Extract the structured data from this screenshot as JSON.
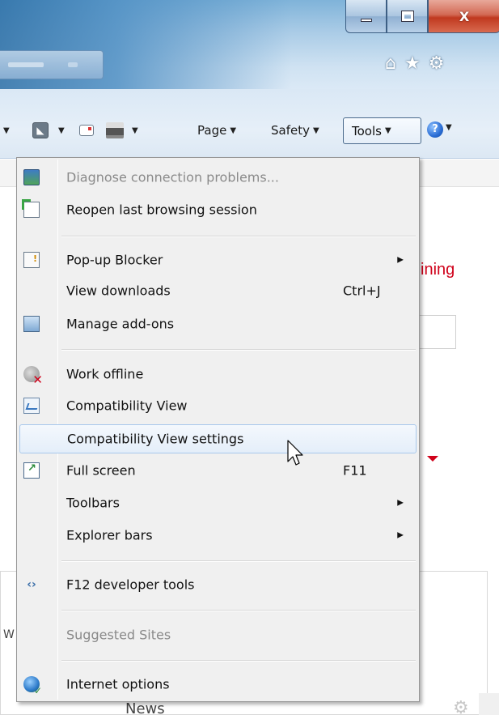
{
  "window": {
    "caption_buttons": {
      "minimize_icon": "minimize-icon",
      "maximize_icon": "restore-icon",
      "close_glyph": "X"
    },
    "nav_icons": [
      "home-icon",
      "favorites-star-icon",
      "gear-icon"
    ],
    "nav_glyphs": [
      "⌂",
      "★",
      "⚙"
    ]
  },
  "command_bar": {
    "page_label": "Page",
    "safety_label": "Safety",
    "tools_label": "Tools",
    "help_glyph": "?"
  },
  "page_behind": {
    "partial_heading": "ining",
    "partial_w": "W",
    "news_label": "News"
  },
  "tools_menu": {
    "items": [
      {
        "label": "Diagnose connection problems...",
        "icon": "diagnose-icon",
        "disabled": true
      },
      {
        "label": "Reopen last browsing session",
        "icon": "reopen-session-icon"
      },
      {
        "label": "Pop-up Blocker",
        "icon": "popup-blocker-icon",
        "submenu": true
      },
      {
        "label": "View downloads",
        "shortcut": "Ctrl+J"
      },
      {
        "label": "Manage add-ons",
        "icon": "add-ons-icon"
      },
      {
        "label": "Work offline",
        "icon": "work-offline-icon"
      },
      {
        "label": "Compatibility View",
        "icon": "compatibility-view-icon"
      },
      {
        "label": "Compatibility View settings",
        "highlighted": true
      },
      {
        "label": "Full screen",
        "icon": "full-screen-icon",
        "shortcut": "F11"
      },
      {
        "label": "Toolbars",
        "submenu": true
      },
      {
        "label": "Explorer bars",
        "submenu": true
      },
      {
        "label": "F12 developer tools",
        "icon": "developer-tools-icon"
      },
      {
        "label": "Suggested Sites",
        "disabled": true
      },
      {
        "label": "Internet options",
        "icon": "internet-options-icon"
      }
    ],
    "submenu_glyph": "▶",
    "f12_glyph": "‹›"
  },
  "colors": {
    "accent_red": "#d0021b",
    "menu_bg": "#f0f0f0",
    "highlight_border": "#a8c8ec"
  }
}
